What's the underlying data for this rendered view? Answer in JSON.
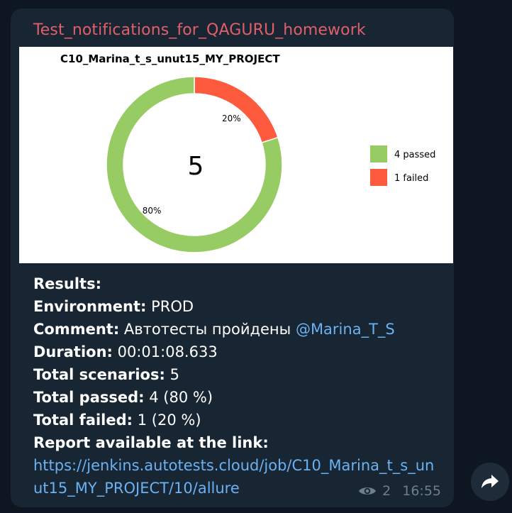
{
  "message": {
    "sender": "Test_notifications_for_QAGURU_homework",
    "lines": {
      "results_label": "Results:",
      "environment_label": "Environment:",
      "environment_value": "PROD",
      "comment_label": "Comment:",
      "comment_value": "Автотесты пройдены",
      "comment_mention": "@Marina_T_S",
      "duration_label": "Duration:",
      "duration_value": "00:01:08.633",
      "scenarios_label": "Total scenarios:",
      "scenarios_value": "5",
      "passed_label": "Total passed:",
      "passed_value": "4 (80 %)",
      "failed_label": "Total failed:",
      "failed_value": "1 (20 %)",
      "report_label": "Report available at the link:",
      "report_url": "https://jenkins.autotests.cloud/job/C10_Marina_t_s_unut15_MY_PROJECT/10/allure"
    },
    "views": "2",
    "time": "16:55"
  },
  "chart_data": {
    "type": "pie",
    "title": "C10_Marina_t_s_unut15_MY_PROJECT",
    "center_label": "5",
    "slices": [
      {
        "label": "4 passed",
        "value": 4,
        "percent_label": "80%",
        "color": "#97cc64"
      },
      {
        "label": "1 failed",
        "value": 1,
        "percent_label": "20%",
        "color": "#fd5a3e"
      }
    ],
    "legend_position": "right"
  },
  "icons": {
    "views": "eye-icon",
    "forward": "forward-arrow-icon"
  }
}
